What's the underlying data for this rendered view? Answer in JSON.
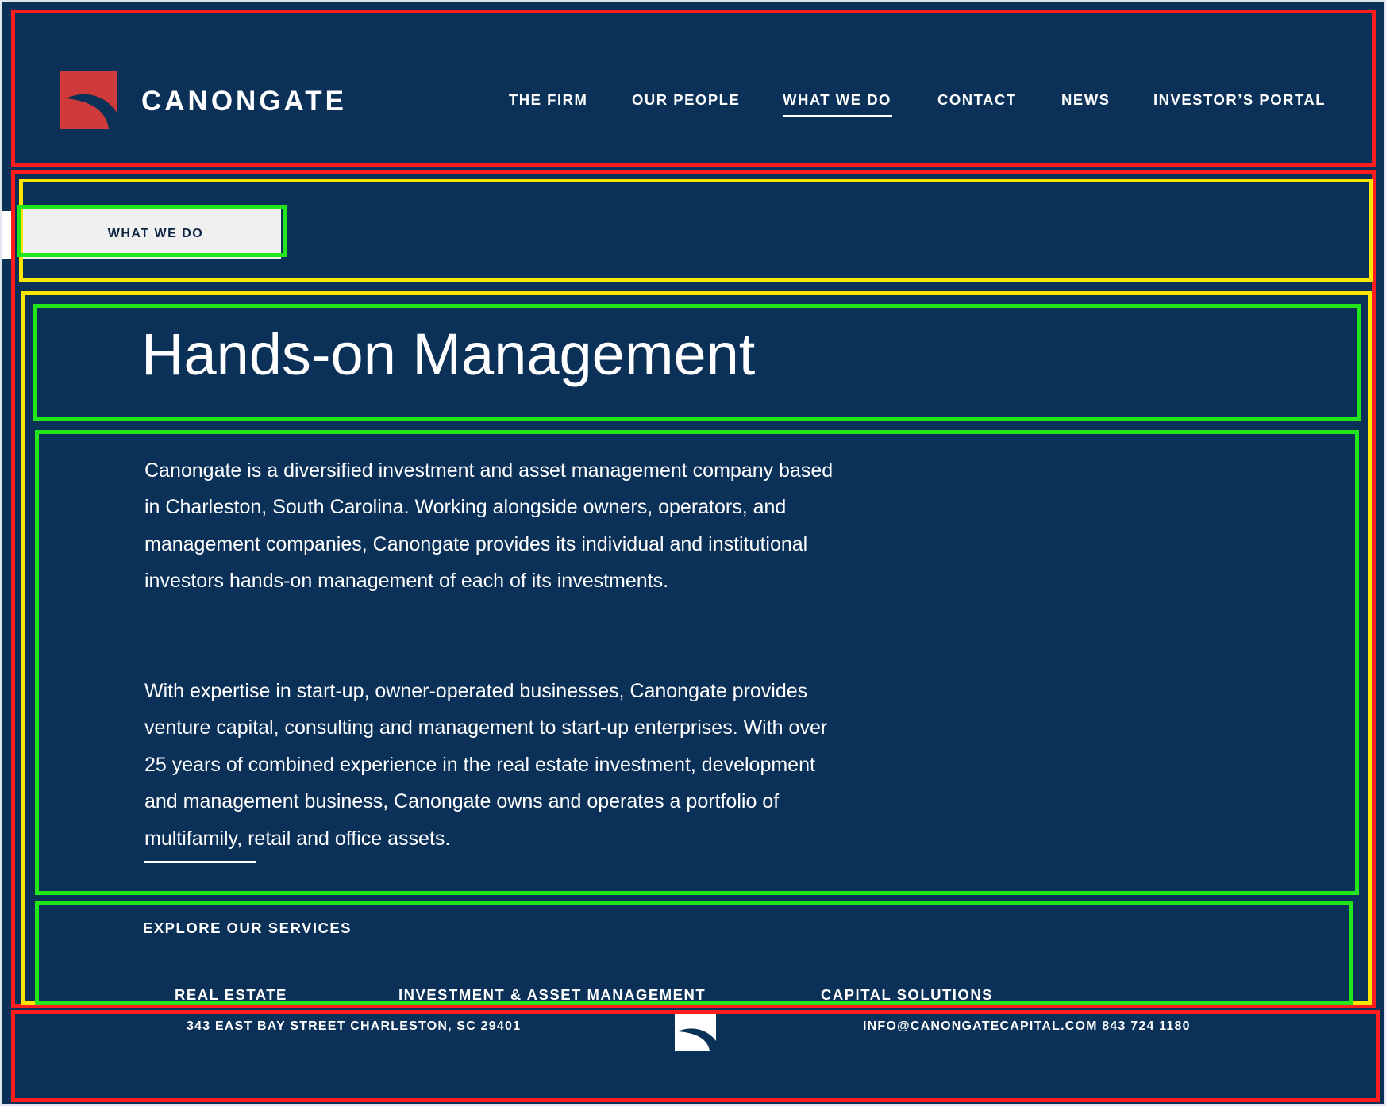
{
  "brand": {
    "name": "CANONGATE",
    "logo_icon": "canongate-logo-icon",
    "logo_color": "#d03a3a"
  },
  "nav": {
    "items": [
      {
        "label": "THE FIRM"
      },
      {
        "label": "OUR PEOPLE"
      },
      {
        "label": "WHAT WE DO"
      },
      {
        "label": "CONTACT"
      },
      {
        "label": "NEWS"
      },
      {
        "label": "INVESTOR’S PORTAL"
      }
    ],
    "active": "WHAT WE DO"
  },
  "breadcrumb": {
    "label": "WHAT WE DO"
  },
  "main": {
    "title": "Hands-on Management",
    "paragraphs": [
      "Canongate is a diversified investment and asset management company based in Charleston, South Carolina. Working alongside owners, operators, and management companies, Canongate provides its individual and institutional investors hands-on management of each of its investments.",
      "With expertise in start-up, owner-operated businesses, Canongate provides venture capital, consulting and management to start-up enterprises. With over 25 years of combined experience in the real estate investment, development and management business, Canongate owns and operates a portfolio of multifamily, retail and office assets."
    ]
  },
  "services": {
    "heading": "EXPLORE OUR SERVICES",
    "items": [
      {
        "label": "REAL ESTATE"
      },
      {
        "label": "INVESTMENT & ASSET MANAGEMENT"
      },
      {
        "label": "CAPITAL SOLUTIONS"
      }
    ]
  },
  "footer": {
    "address": "343 EAST BAY STREET  CHARLESTON, SC 29401",
    "contact": "INFO@CANONGATECAPITAL.COM  843 724 1180",
    "mark_icon": "canongate-mark-icon"
  },
  "colors": {
    "background": "#0b3158",
    "text": "#ffffff",
    "annotation_red": "#ff1d1d",
    "annotation_yellow": "#ffe600",
    "annotation_green": "#22e51a"
  }
}
